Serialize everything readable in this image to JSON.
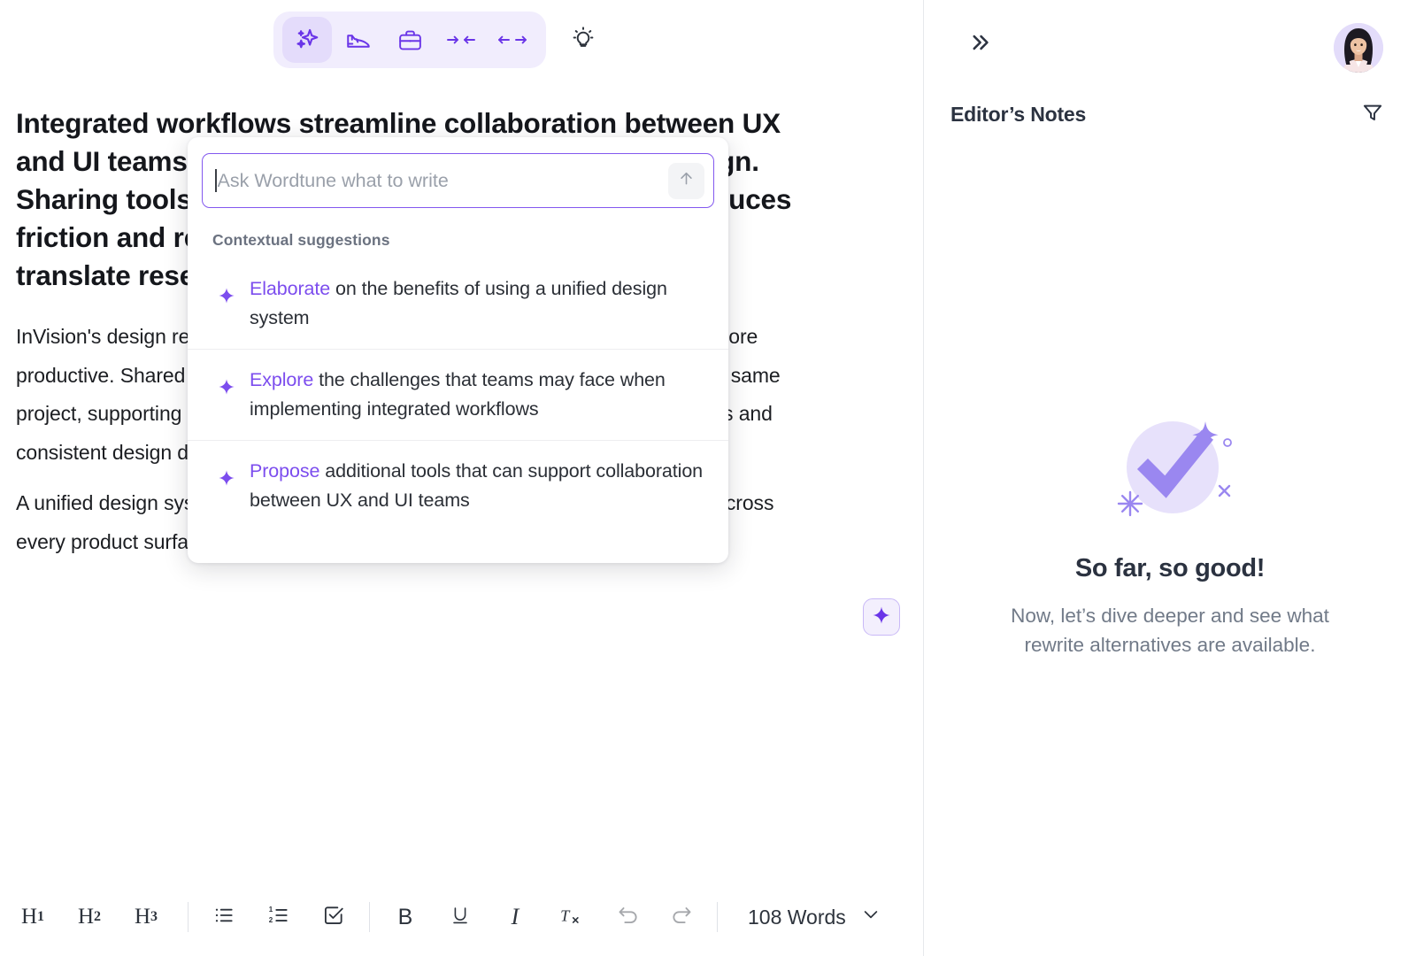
{
  "accent": {
    "purple": "#7c4dee",
    "purple_strong": "#6a35e8",
    "lavender_bg": "#f1edfd",
    "text_dark": "#1c1e22",
    "muted": "#717a88"
  },
  "tone_toolbar": {
    "items": [
      {
        "icon": "sparkles-icon",
        "label": "Rewrite"
      },
      {
        "icon": "shoe-icon",
        "label": "Casual"
      },
      {
        "icon": "briefcase-icon",
        "label": "Formal"
      },
      {
        "icon": "shorten-icon",
        "label": "Shorten"
      },
      {
        "icon": "expand-icon",
        "label": "Expand"
      }
    ],
    "bulb": {
      "icon": "lightbulb-icon",
      "label": "Ideas"
    }
  },
  "document": {
    "heading": "Integrated workflows streamline collaboration between UX and UI teams by creating a cohesive approach to design. Sharing tools, assets, and standardized processes reduces friction and rework. These workflows make it easier to translate research into intuitive UI experiences.",
    "paragraphs": [
      "InVision's design reports reveal that teams with integrated workflows are 34% more productive. Shared tools like Figma and Adobe XD let designers work within the same project, supporting real-time feedback and communication, quick feedback loops and consistent design decisions.",
      "A unified design system keeps visual language and component usage aligned across every product surface, and it keeps designers aligned with the product vision. +"
    ]
  },
  "ai_popup": {
    "input_placeholder": "Ask Wordtune what to write",
    "input_value": "",
    "send_icon": "arrow-up-icon",
    "suggestions_label": "Contextual suggestions",
    "suggestions": [
      {
        "verb": "Elaborate",
        "rest": " on the benefits of using a unified design system"
      },
      {
        "verb": "Explore",
        "rest": " the challenges that teams may face when implementing integrated workflows"
      },
      {
        "verb": "Propose",
        "rest": " additional tools that can support collaboration between UX and UI teams"
      }
    ]
  },
  "bottom_toolbar": {
    "headings": [
      {
        "letter": "H",
        "level": "1",
        "name": "heading-1"
      },
      {
        "letter": "H",
        "level": "2",
        "name": "heading-2"
      },
      {
        "letter": "H",
        "level": "3",
        "name": "heading-3"
      }
    ],
    "lists": [
      "bullet-list-icon",
      "numbered-list-icon",
      "checklist-icon"
    ],
    "format": [
      {
        "label": "B",
        "name": "bold"
      },
      {
        "label": "U",
        "name": "underline"
      },
      {
        "label": "I",
        "name": "italic"
      },
      {
        "label": "Tx",
        "name": "clear-formatting"
      }
    ],
    "history": [
      "undo-icon",
      "redo-icon"
    ],
    "word_count": "108 Words",
    "word_count_chevron": "chevron-down-icon"
  },
  "notes_panel": {
    "collapse_icon": "chevron-double-right-icon",
    "title": "Editor’s Notes",
    "filter_icon": "filter-icon",
    "empty_state": {
      "illustration": "check-sparkle-icon",
      "title": "So far, so good!",
      "subtitle": "Now, let’s dive deeper and see what rewrite alternatives are available."
    }
  }
}
